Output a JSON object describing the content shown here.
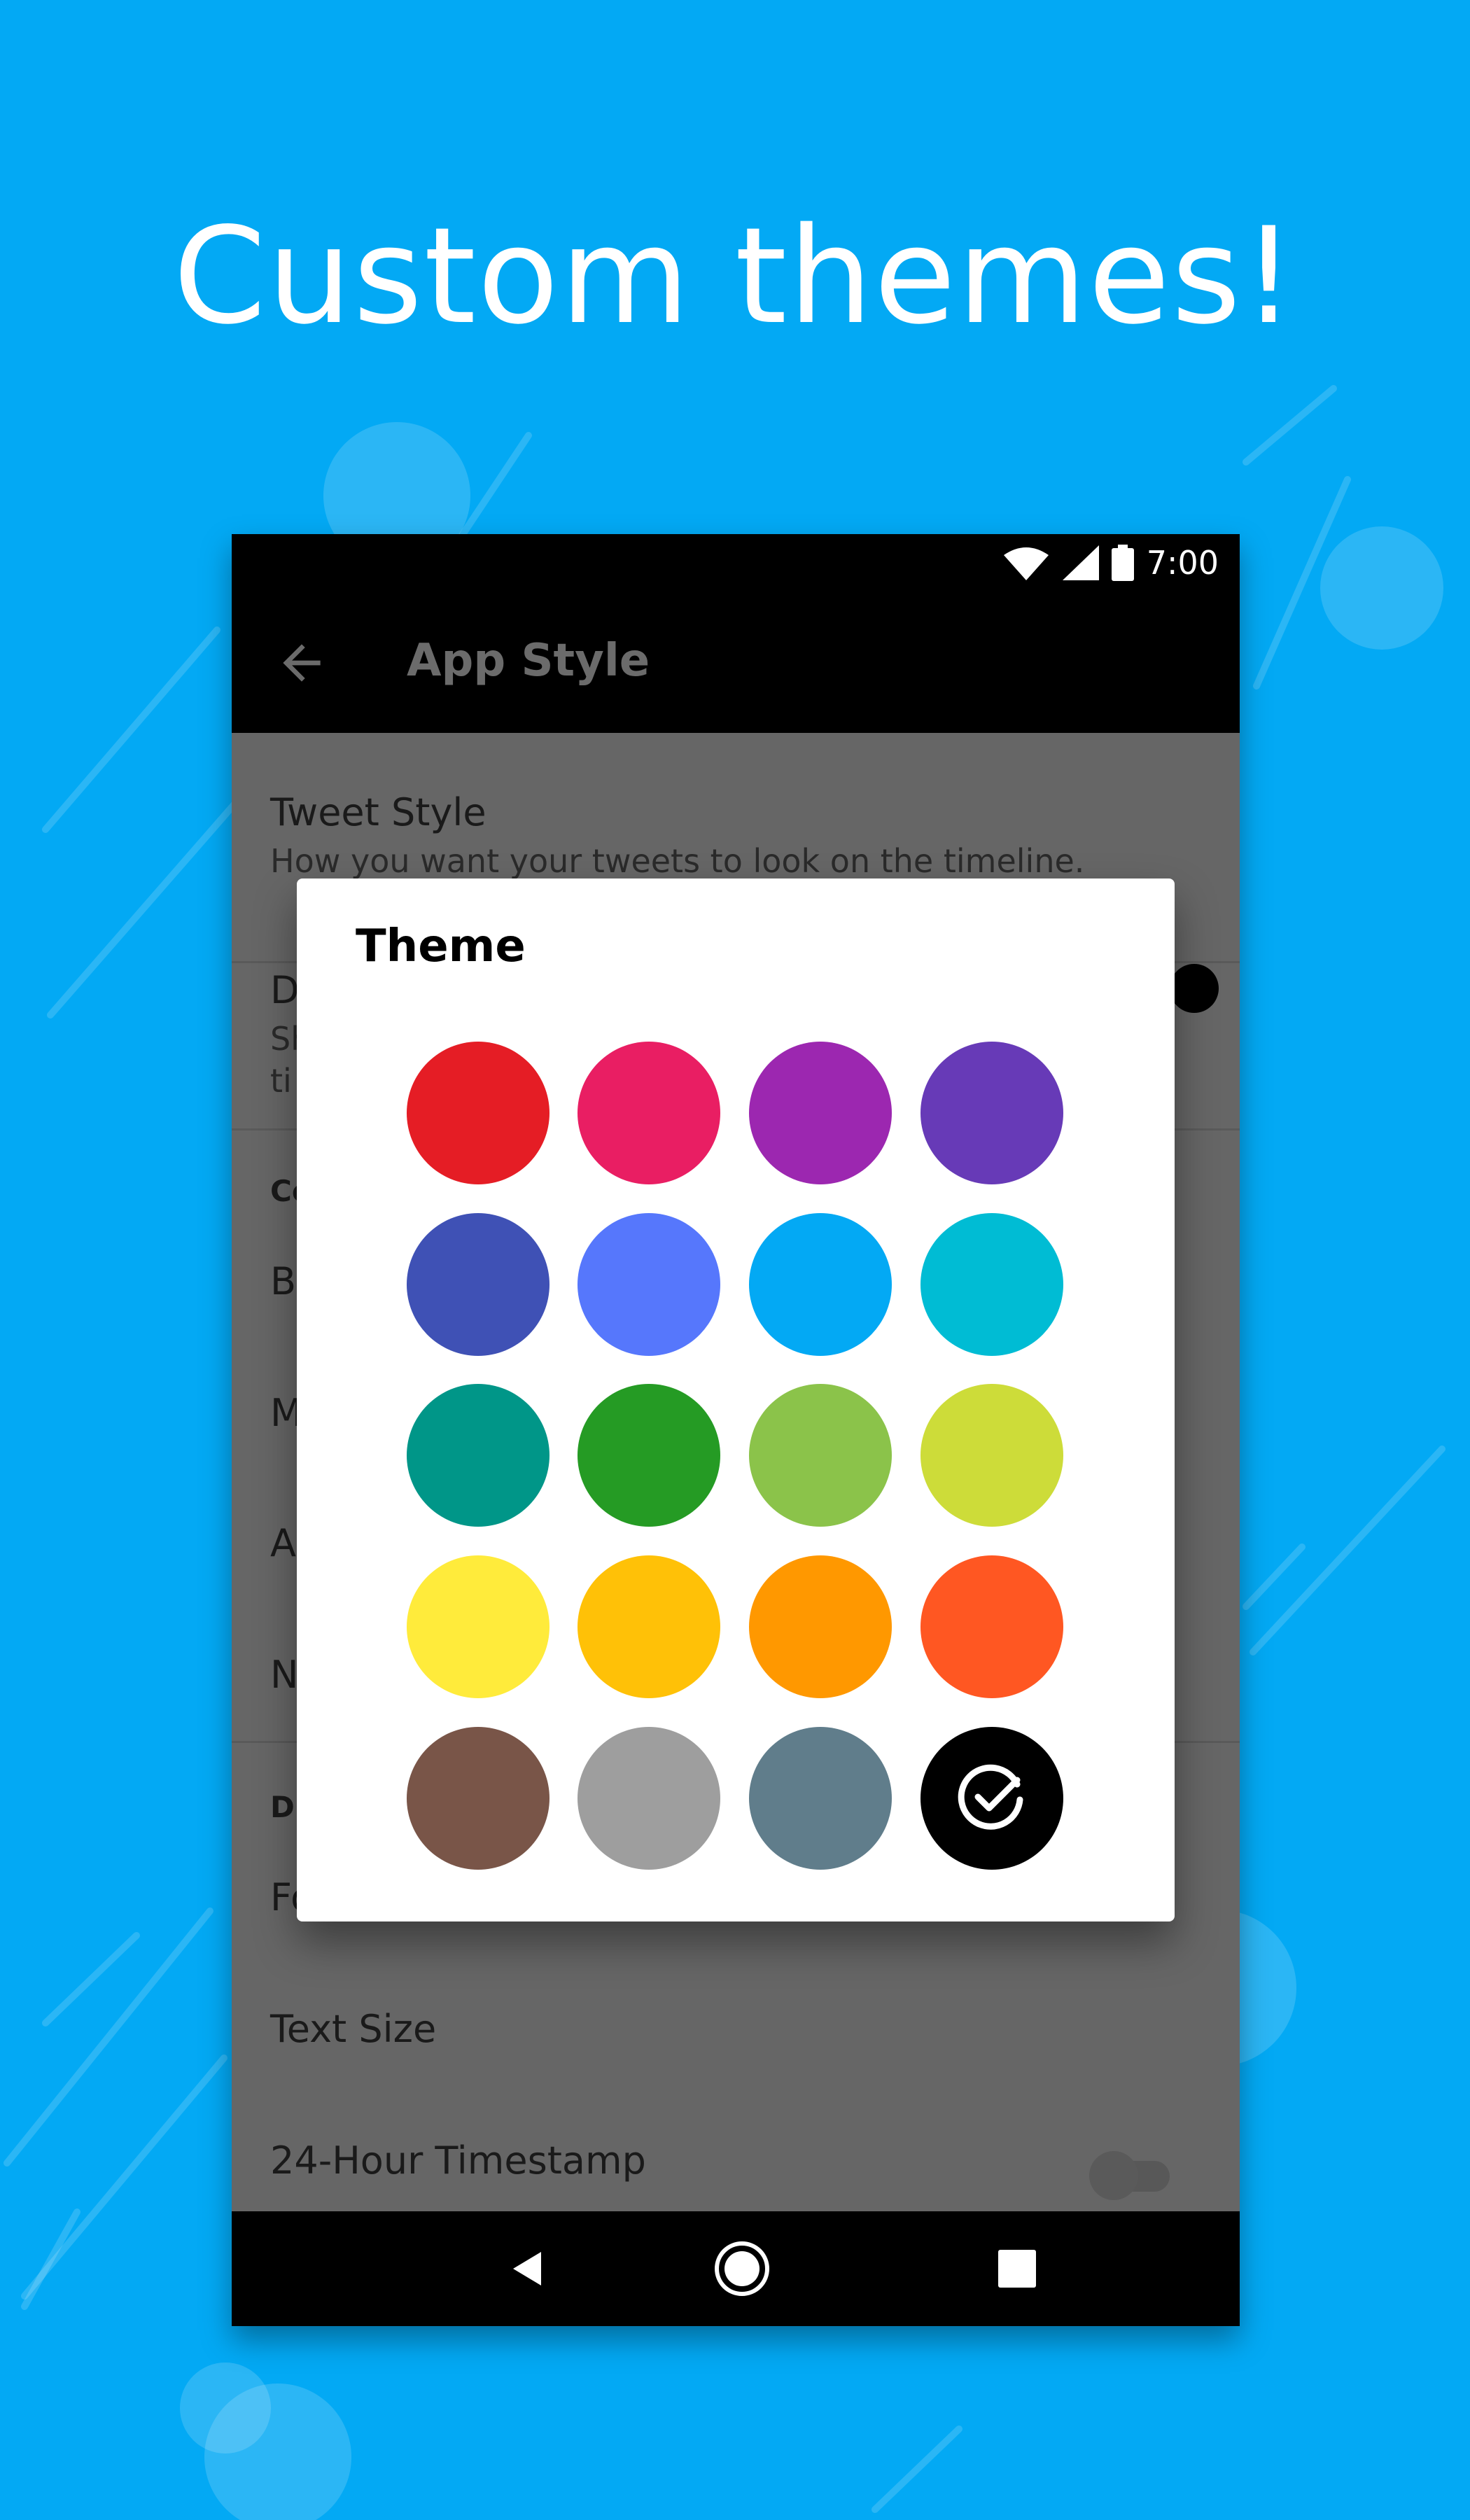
{
  "promo": {
    "headline": "Custom themes!"
  },
  "status_bar": {
    "time": "7:00"
  },
  "toolbar": {
    "title": "App Style",
    "back_icon": "arrow-back-icon"
  },
  "settings": {
    "tweet_style": {
      "title": "Tweet Style",
      "subtitle": "How you want your tweets to look on the timeline."
    },
    "partial_rows": {
      "d": "D",
      "s": "Sh",
      "ti": "ti",
      "co": "Co",
      "b": "B",
      "m": "M",
      "a": "A",
      "n": "N",
      "di": "Di",
      "f": "Fo"
    },
    "text_size": "Text Size",
    "timestamp": "24-Hour Timestamp",
    "timestamp_enabled": false
  },
  "dialog": {
    "title": "Theme",
    "swatches": [
      "#E51D25",
      "#E91E63",
      "#9C27B0",
      "#673AB7",
      "#3F51B5",
      "#5677FC",
      "#03A9F4",
      "#00BCD4",
      "#009688",
      "#259B24",
      "#8BC34A",
      "#CDDC39",
      "#FFEB3B",
      "#FFC107",
      "#FF9800",
      "#FF5722",
      "#795548",
      "#9E9E9E",
      "#607D8B",
      "#000000"
    ],
    "selected_index": 19,
    "selected_icon": "check-circle-icon"
  },
  "colors": {
    "background": "#03A9F4",
    "dialog": "#FFFFFF",
    "scrim": "#666666"
  }
}
